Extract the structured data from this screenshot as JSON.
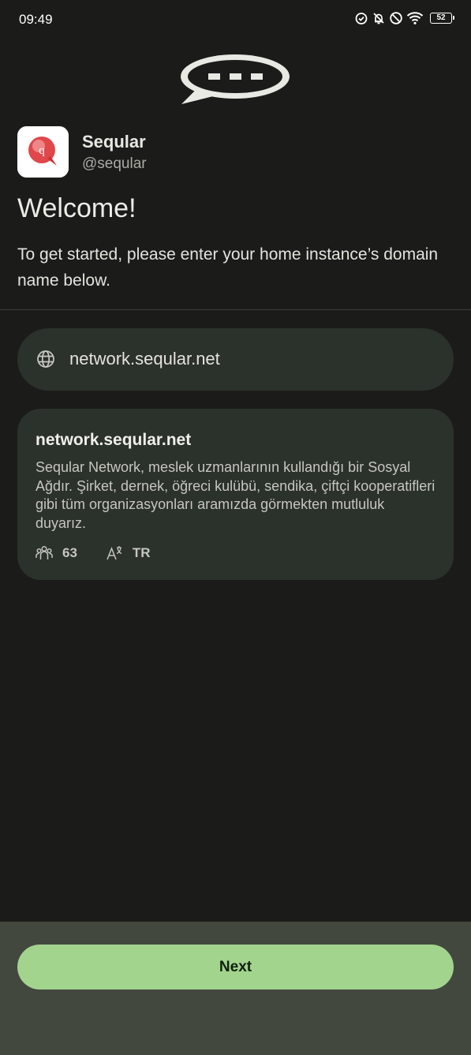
{
  "status_bar": {
    "time": "09:49",
    "battery_level": "52",
    "icons": [
      "alarm-check-icon",
      "notifications-off-icon",
      "do-not-disturb-icon",
      "wifi-icon",
      "battery-icon"
    ]
  },
  "header": {
    "logo_icon": "speech-bubble-icon"
  },
  "instance": {
    "name": "Seqular",
    "handle": "@seqular",
    "app_icon": "seqular-app-icon"
  },
  "welcome": {
    "title": "Welcome!",
    "instructions": "To get started, please enter your home instance’s domain name below."
  },
  "domain_input": {
    "value": "network.seqular.net",
    "icon": "globe-icon"
  },
  "instance_card": {
    "domain": "network.seqular.net",
    "description": "Seqular Network, meslek uzmanlarının kullandığı bir Sosyal Ağdır. Şirket, dernek, öğreci kulübü, sendika, çiftçi kooperatifleri gibi tüm organizasyonları aramızda görmekten mutluluk duyarız.",
    "users_count": "63",
    "language": "TR"
  },
  "footer": {
    "next_label": "Next"
  },
  "colors": {
    "background": "#1b1c1a",
    "card": "#2b312b",
    "accent": "#a3d48e",
    "bottom_bar": "#43483f"
  }
}
